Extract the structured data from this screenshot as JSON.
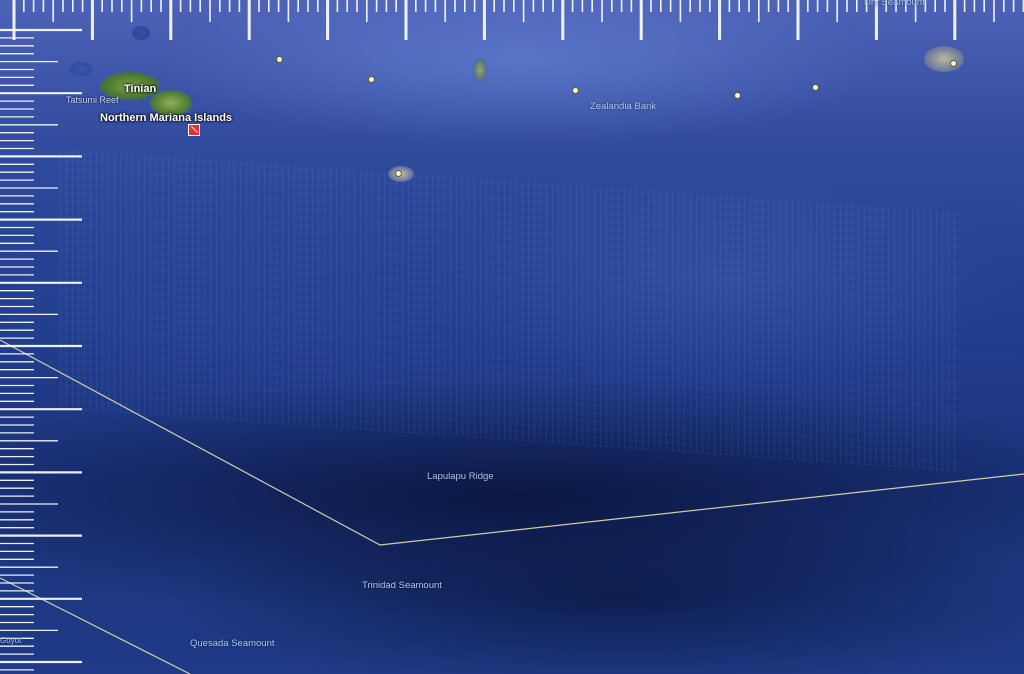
{
  "map": {
    "place_labels": {
      "tinian": "Tinian",
      "northern_mariana_islands": "Northern Mariana Islands",
      "tatsumi_reef": "Tatsumi Reef",
      "zealandia_bank": "Zealandia Bank",
      "lapulapu_ridge": "Lapulapu Ridge",
      "trinidad_seamount": "Trinidad Seamount",
      "quesada_seamount": "Quesada Seamount",
      "guyot_partial": "Guyot",
      "top_right_partial": "Dry Seamount"
    },
    "colors": {
      "ocean_deep": "#1b347d",
      "ocean_shallow": "#4d63b8",
      "label_blue": "#a9c8f2",
      "boundary_line": "#e8dfb0",
      "marker_red": "#e53030",
      "land_green": "#5f8f3c"
    },
    "icons": {
      "marker": "red-square-marker-icon",
      "seamount": "seamount-dot-icon"
    }
  }
}
